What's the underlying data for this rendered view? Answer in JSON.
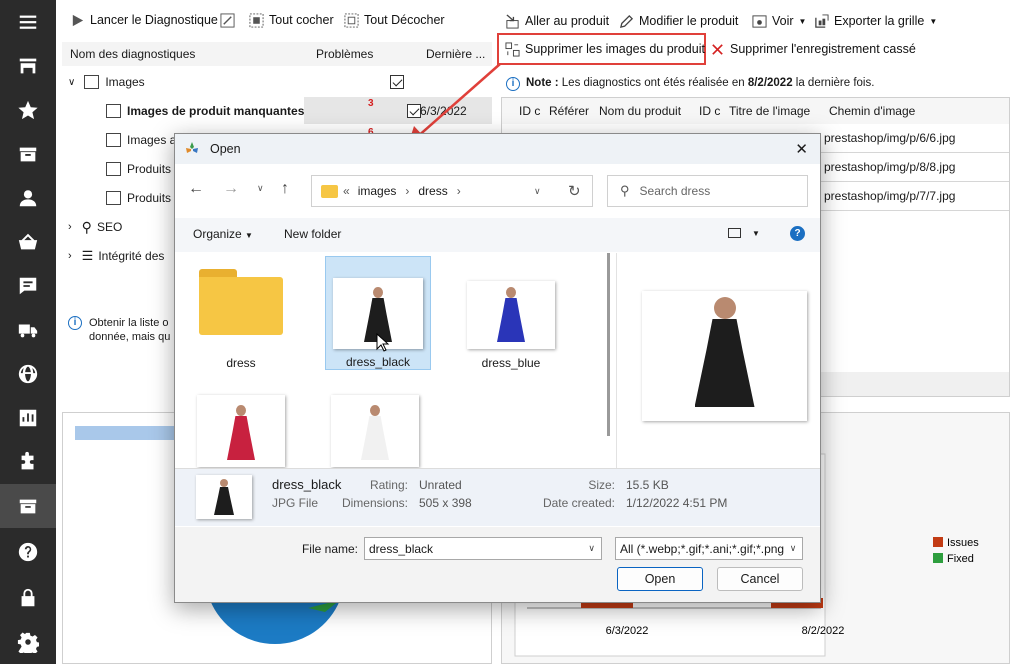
{
  "toolbar": {
    "run": "Lancer le Diagnostique",
    "check_all": "Tout cocher",
    "uncheck_all": "Tout Décocher",
    "goto_product": "Aller au produit",
    "edit_product": "Modifier le produit",
    "view": "Voir",
    "export_grid": "Exporter la grille",
    "delete_images": "Supprimer les images du produit",
    "delete_broken": "Supprimer l'enregistrement cassé"
  },
  "tree": {
    "col_name": "Nom des diagnostiques",
    "col_issues": "Problèmes",
    "col_last": "Dernière ...",
    "images": "Images",
    "missing_images": "Images de produit manquantes",
    "missing_count": "3",
    "missing_date": "6/3/2022",
    "images_a": "Images a",
    "count2": "6",
    "produits1": "Produits",
    "produits2": "Produits",
    "seo": "SEO",
    "integrity": "Intégrité des"
  },
  "info": {
    "line1": "Obtenir la liste o",
    "line2": "donnée, mais qu"
  },
  "note": {
    "label": "Note :",
    "text": " Les diagnostics ont étés réalisée en ",
    "date": "8/2/2022",
    "tail": " la dernière fois."
  },
  "grid": {
    "headers": [
      "ID c",
      "Référer",
      "Nom du produit",
      "ID c",
      "Titre de l'image",
      "Chemin d'image"
    ],
    "paths": [
      "prestashop/img/p/6/6.jpg",
      "prestashop/img/p/8/8.jpg",
      "prestashop/img/p/7/7.jpg"
    ]
  },
  "chart_data": {
    "type": "bar",
    "categories": [
      "6/3/2022",
      "8/2/2022"
    ],
    "series": [
      {
        "name": "Issues"
      },
      {
        "name": "Fixed"
      }
    ],
    "legend": "right",
    "colors": {
      "issues": "#c23b14",
      "fixed": "#2e9e3e"
    }
  },
  "dialog": {
    "title": "Open",
    "path": [
      "images",
      "dress"
    ],
    "search_placeholder": "Search dress",
    "organize": "Organize",
    "new_folder": "New folder",
    "files": [
      {
        "name": "dress",
        "kind": "folder"
      },
      {
        "name": "dress_black",
        "kind": "image",
        "color": "#1d1d1d"
      },
      {
        "name": "dress_blue",
        "kind": "image",
        "color": "#2a35b8"
      },
      {
        "name": "",
        "kind": "image",
        "color": "#c8213f"
      },
      {
        "name": "",
        "kind": "image",
        "color": "#f1f1f1"
      }
    ],
    "details": {
      "name": "dress_black",
      "type": "JPG File",
      "rating_label": "Rating:",
      "rating": "Unrated",
      "dim_label": "Dimensions:",
      "dimensions": "505 x 398",
      "size_label": "Size:",
      "size": "15.5 KB",
      "date_label": "Date created:",
      "date": "1/12/2022 4:51 PM"
    },
    "file_name_label": "File name:",
    "file_name": "dress_black",
    "filter": "All (*.webp;*.gif;*.ani;*.gif;*.png",
    "open": "Open",
    "cancel": "Cancel"
  },
  "colors": {
    "accent": "#e0403a",
    "sidebar": "#2b2b2b",
    "dialog_select": "#cce4f7"
  }
}
